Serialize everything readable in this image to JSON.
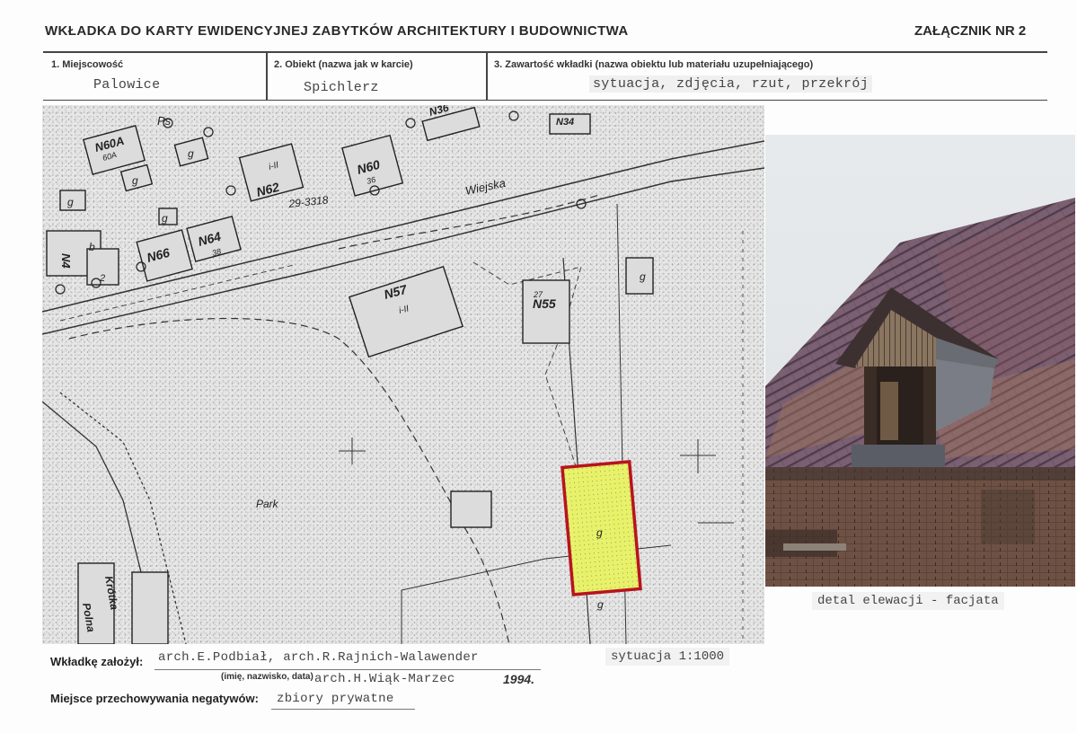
{
  "header": {
    "title": "WKŁADKA DO KARTY EWIDENCYJNEJ ZABYTKÓW ARCHITEKTURY I BUDOWNICTWA",
    "attachment": "ZAŁĄCZNIK NR 2"
  },
  "fields": {
    "f1": {
      "label": "1. Miejscowość",
      "value": "Palowice"
    },
    "f2": {
      "label": "2. Obiekt (nazwa jak w karcie)",
      "value": "Spichlerz"
    },
    "f3": {
      "label": "3. Zawartość wkładki (nazwa obiektu lub materiału uzupełniającego)",
      "value": "sytuacja, zdjęcia, rzut, przekrój"
    }
  },
  "map": {
    "labels": {
      "ps": "Ps",
      "n60a": "N60A",
      "n60a_sub": "60A",
      "n60": "N60",
      "n60_sub": "36",
      "n62": "N62",
      "i_ii_a": "i-II",
      "i_ii_b": "i-II",
      "road_no": "29-3318",
      "street": "Wiejska",
      "n66": "N66",
      "n64": "N64",
      "n64_sub": "38",
      "n57": "N57",
      "n55": "N55",
      "n55_sub": "27",
      "park": "Park",
      "g": "g",
      "b": "b",
      "two": "2",
      "n4": "N4",
      "street2": "Krótka",
      "street3": "Polna",
      "n36": "N36",
      "n36_sub": "36",
      "n34": "N34",
      "n34_sub": "34"
    },
    "scale": "sytuacja 1:1000"
  },
  "photo": {
    "caption": "detal elewacji - facjata"
  },
  "footer": {
    "founded_label": "Wkładkę założył:",
    "founded_value1": "arch.E.Podbiał, arch.R.Rajnich-Walawender",
    "founded_hint": "(imię, nazwisko, data)",
    "founded_value2": "arch.H.Wiąk-Marzec",
    "year": "1994.",
    "negatives_label": "Miejsce przechowywania negatywów:",
    "negatives_value": "zbiory prywatne"
  }
}
